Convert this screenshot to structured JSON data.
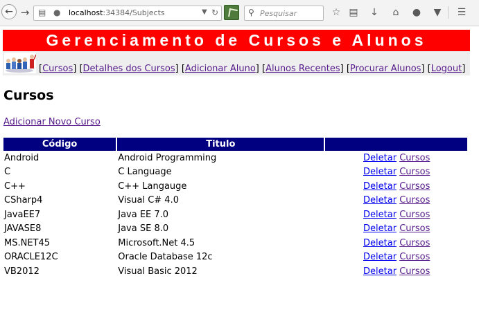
{
  "browser": {
    "url_host": "localhost",
    "url_path": ":34384/Subjects",
    "search_placeholder": "Pesquisar"
  },
  "header": {
    "title": "Gerenciamento de Cursos e Alunos"
  },
  "nav": {
    "items": [
      {
        "label": "Cursos"
      },
      {
        "label": "Detalhes dos Cursos"
      },
      {
        "label": "Adicionar Aluno"
      },
      {
        "label": "Alunos Recentes"
      },
      {
        "label": "Procurar Alunos"
      },
      {
        "label": "Logout"
      }
    ]
  },
  "main": {
    "title": "Cursos",
    "add_link": "Adicionar Novo Curso",
    "table": {
      "headers": [
        "Código",
        "Titulo",
        ""
      ],
      "delete_label": "Deletar",
      "courses_label": "Cursos",
      "rows": [
        {
          "code": "Android",
          "title": "Android Programming"
        },
        {
          "code": "C",
          "title": "C Language"
        },
        {
          "code": "C++",
          "title": "C++ Langauge"
        },
        {
          "code": "CSharp4",
          "title": "Visual C# 4.0"
        },
        {
          "code": "JavaEE7",
          "title": "Java EE 7.0"
        },
        {
          "code": "JAVASE8",
          "title": "Java SE 8.0"
        },
        {
          "code": "MS.NET45",
          "title": "Microsoft.Net 4.5"
        },
        {
          "code": "ORACLE12C",
          "title": "Oracle Database 12c"
        },
        {
          "code": "VB2012",
          "title": "Visual Basic 2012"
        }
      ]
    }
  },
  "icons": {
    "back": "back-arrow-icon",
    "forward": "forward-arrow-icon",
    "search": "search-icon"
  },
  "colors": {
    "banner": "#ff0000",
    "table_header": "#000080",
    "link": "#0000ee",
    "visited_link": "#551a8b"
  }
}
